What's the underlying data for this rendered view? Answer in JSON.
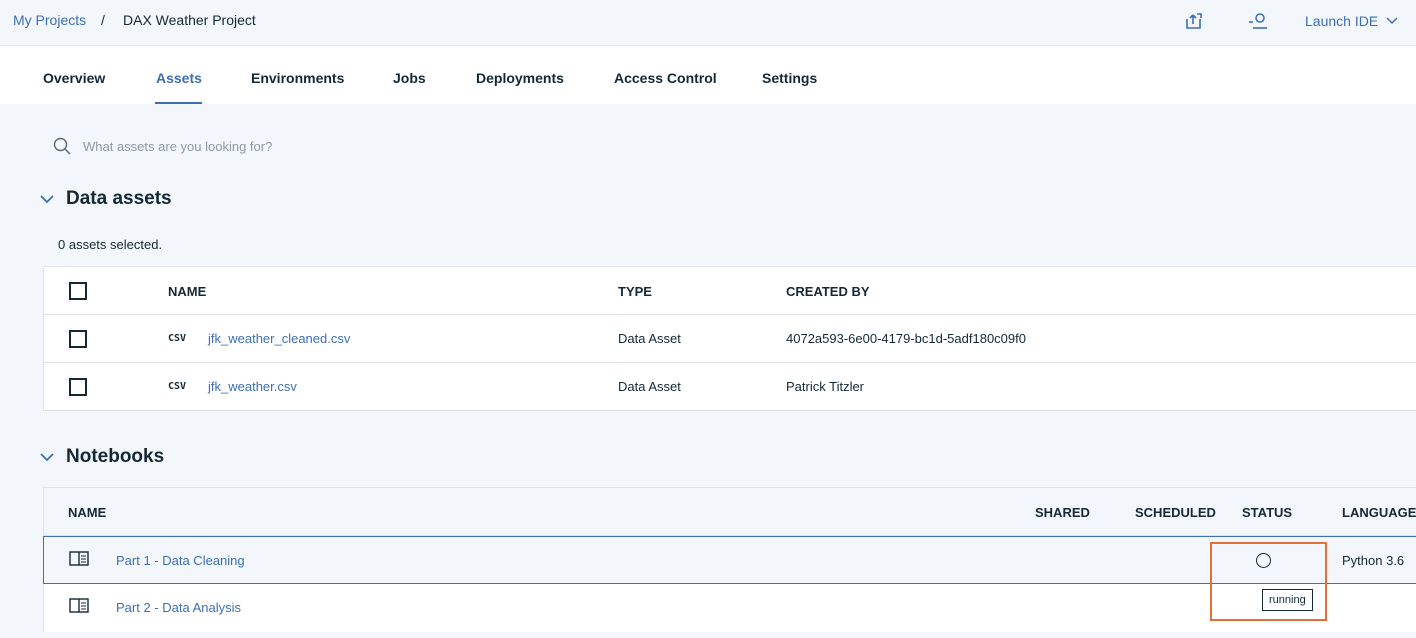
{
  "breadcrumb": {
    "parent": "My Projects",
    "separator": "/",
    "current": "DAX Weather Project"
  },
  "header": {
    "icons": [
      "share-icon",
      "add-collaborator-icon"
    ],
    "launch_label": "Launch IDE"
  },
  "tabs": [
    "Overview",
    "Assets",
    "Environments",
    "Jobs",
    "Deployments",
    "Access Control",
    "Settings"
  ],
  "active_tab": "Assets",
  "search": {
    "placeholder": "What assets are you looking for?"
  },
  "data_assets": {
    "title": "Data assets",
    "selected_text": "0 assets selected.",
    "columns": [
      "NAME",
      "TYPE",
      "CREATED BY"
    ],
    "rows": [
      {
        "format": "CSV",
        "name": "jfk_weather_cleaned.csv",
        "type": "Data Asset",
        "created_by": "4072a593-6e00-4179-bc1d-5adf180c09f0"
      },
      {
        "format": "CSV",
        "name": "jfk_weather.csv",
        "type": "Data Asset",
        "created_by": "Patrick Titzler"
      }
    ]
  },
  "notebooks": {
    "title": "Notebooks",
    "columns": [
      "NAME",
      "SHARED",
      "SCHEDULED",
      "STATUS",
      "LANGUAGE"
    ],
    "rows": [
      {
        "name": "Part 1 - Data Cleaning",
        "language": "Python 3.6",
        "status_icon": "status-circle-icon"
      },
      {
        "name": "Part 2 - Data Analysis",
        "language": ""
      }
    ],
    "status_tooltip": "running"
  },
  "colors": {
    "accent": "#3d70b2",
    "highlight": "#e36f39",
    "text": "#152935"
  }
}
